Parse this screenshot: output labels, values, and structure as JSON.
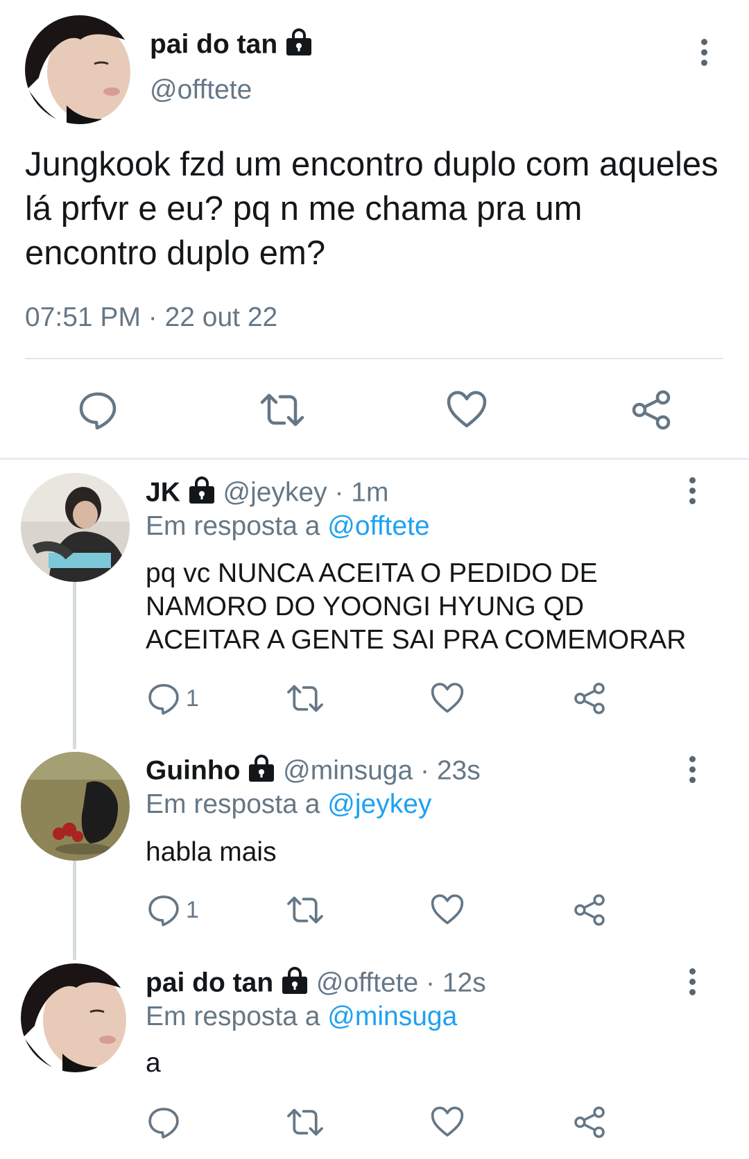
{
  "main_tweet": {
    "display_name": "pai do tan",
    "handle": "@offtete",
    "text": "Jungkook fzd um encontro duplo com aqueles lá prfvr e eu? pq n me chama pra um encontro duplo em?",
    "timestamp": "07:51 PM · 22 out 22",
    "protected": true,
    "actions": [
      "reply-icon",
      "retweet-icon",
      "like-icon",
      "share-icon"
    ]
  },
  "replies": [
    {
      "display_name": "JK",
      "handle": "@jeykey",
      "time": "· 1m",
      "in_reply_prefix": "Em resposta a",
      "in_reply_to": "@offtete",
      "text": "pq vc NUNCA ACEITA O PEDIDO DE NAMORO DO YOONGI HYUNG QD ACEITAR A GENTE SAI PRA COMEMORAR",
      "reply_count": "1"
    },
    {
      "display_name": "Guinho",
      "handle": "@minsuga",
      "time": "· 23s",
      "in_reply_prefix": "Em resposta a",
      "in_reply_to": "@jeykey",
      "text": "habla mais",
      "reply_count": "1"
    },
    {
      "display_name": "pai do tan",
      "handle": "@offtete",
      "time": "· 12s",
      "in_reply_prefix": "Em resposta a",
      "in_reply_to": "@minsuga",
      "text": "a",
      "reply_count": ""
    }
  ],
  "colors": {
    "link": "#1da1f2",
    "secondary_text": "#657786",
    "icon": "#657786",
    "divider": "#e1e8ed"
  }
}
